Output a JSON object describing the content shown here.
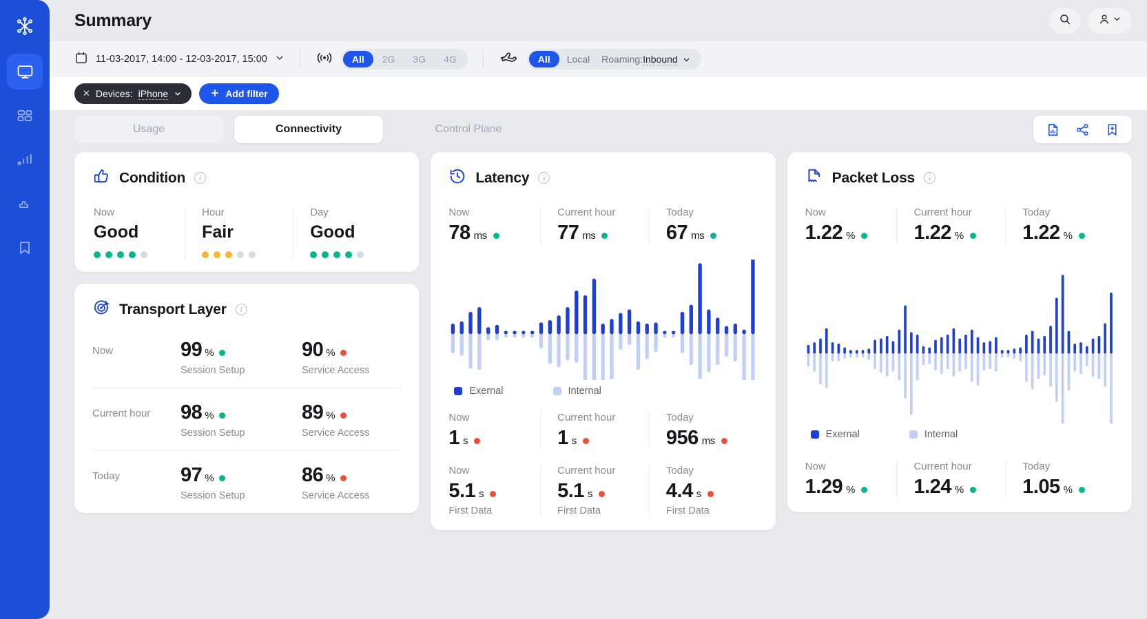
{
  "sidebar": {
    "items": [
      {
        "icon": "network-nodes-logo-icon",
        "name": "logo"
      },
      {
        "icon": "monitor-icon",
        "name": "monitoring",
        "active": true
      },
      {
        "icon": "dashboard-grid-icon",
        "name": "dashboards"
      },
      {
        "icon": "bar-chart-icon",
        "name": "analytics"
      },
      {
        "icon": "puzzle-icon",
        "name": "integrations"
      },
      {
        "icon": "bookmark-icon",
        "name": "saved"
      }
    ]
  },
  "header": {
    "title": "Summary",
    "search_icon": "search-icon",
    "user_icon": "user-icon",
    "chevron_icon": "chevron-down-icon"
  },
  "filters": {
    "calendar_icon": "calendar-icon",
    "date_range": "11-03-2017, 14:00 - 12-03-2017, 15:00",
    "date_chevron": "chevron-down-icon",
    "network_icon": "signal-waves-icon",
    "network_options": [
      "All",
      "2G",
      "3G",
      "4G"
    ],
    "network_selected": "All",
    "roaming_icon": "airplane-icon",
    "roaming_options": [
      "All",
      "Local"
    ],
    "roaming_selected": "All",
    "roaming_label": "Roaming:",
    "roaming_value": "Inbound",
    "roaming_value_chevron": "chevron-down-icon",
    "chip": {
      "close_icon": "close-x-icon",
      "label": "Devices:",
      "value": "iPhone",
      "chevron": "chevron-down-icon"
    },
    "add_filter": {
      "plus_icon": "plus-icon",
      "label": "Add filter"
    }
  },
  "tabs": {
    "items": [
      {
        "label": "Usage",
        "active": false,
        "muted": false
      },
      {
        "label": "Connectivity",
        "active": true,
        "muted": false
      },
      {
        "label": "Control Plane",
        "active": false,
        "muted": true
      }
    ],
    "actions": [
      {
        "icon": "report-document-icon"
      },
      {
        "icon": "share-icon"
      },
      {
        "icon": "bookmark-add-icon"
      }
    ]
  },
  "cards": {
    "condition": {
      "icon": "thumbs-up-icon",
      "title": "Condition",
      "info_icon": "info-icon",
      "cells": [
        {
          "label": "Now",
          "value": "Good",
          "filled": 4,
          "total": 5,
          "color": "green"
        },
        {
          "label": "Hour",
          "value": "Fair",
          "filled": 3,
          "total": 5,
          "color": "amber"
        },
        {
          "label": "Day",
          "value": "Good",
          "filled": 4,
          "total": 5,
          "color": "green"
        }
      ]
    },
    "transport_layer": {
      "icon": "target-dart-icon",
      "title": "Transport Layer",
      "info_icon": "info-icon",
      "rows": [
        {
          "label": "Now",
          "metrics": [
            {
              "value": "99",
              "unit": "%",
              "status": "green",
              "sub": "Session Setup"
            },
            {
              "value": "90",
              "unit": "%",
              "status": "red",
              "sub": "Service Access"
            }
          ]
        },
        {
          "label": "Current hour",
          "metrics": [
            {
              "value": "98",
              "unit": "%",
              "status": "green",
              "sub": "Session Setup"
            },
            {
              "value": "89",
              "unit": "%",
              "status": "red",
              "sub": "Service Access"
            }
          ]
        },
        {
          "label": "Today",
          "metrics": [
            {
              "value": "97",
              "unit": "%",
              "status": "green",
              "sub": "Session Setup"
            },
            {
              "value": "86",
              "unit": "%",
              "status": "red",
              "sub": "Service Access"
            }
          ]
        }
      ]
    },
    "latency": {
      "icon": "clock-history-icon",
      "title": "Latency",
      "info_icon": "info-icon",
      "top_stats": [
        {
          "label": "Now",
          "value": "78",
          "unit": "ms",
          "status": "green"
        },
        {
          "label": "Current hour",
          "value": "77",
          "unit": "ms",
          "status": "green"
        },
        {
          "label": "Today",
          "value": "67",
          "unit": "ms",
          "status": "green"
        }
      ],
      "legend": [
        {
          "label": "Exernal",
          "color": "#1d3fd8"
        },
        {
          "label": "Internal",
          "color": "#c2d0f7"
        }
      ],
      "mid_stats": [
        {
          "label": "Now",
          "value": "1",
          "unit": "s",
          "status": "red"
        },
        {
          "label": "Current hour",
          "value": "1",
          "unit": "s",
          "status": "red"
        },
        {
          "label": "Today",
          "value": "956",
          "unit": "ms",
          "status": "red"
        }
      ],
      "bottom_stats": [
        {
          "label": "Now",
          "value": "5.1",
          "unit": "s",
          "status": "red",
          "sub": "First Data"
        },
        {
          "label": "Current hour",
          "value": "5.1",
          "unit": "s",
          "status": "red",
          "sub": "First Data"
        },
        {
          "label": "Today",
          "value": "4.4",
          "unit": "s",
          "status": "red",
          "sub": "First Data"
        }
      ]
    },
    "packet_loss": {
      "icon": "packet-torn-icon",
      "title": "Packet Loss",
      "info_icon": "info-icon",
      "top_stats": [
        {
          "label": "Now",
          "value": "1.22",
          "unit": "%",
          "status": "green"
        },
        {
          "label": "Current hour",
          "value": "1.22",
          "unit": "%",
          "status": "green"
        },
        {
          "label": "Today",
          "value": "1.22",
          "unit": "%",
          "status": "green"
        }
      ],
      "legend": [
        {
          "label": "Exernal",
          "color": "#1d3fd8"
        },
        {
          "label": "Internal",
          "color": "#c2d0f7"
        }
      ],
      "bottom_stats": [
        {
          "label": "Now",
          "value": "1.29",
          "unit": "%",
          "status": "green"
        },
        {
          "label": "Current hour",
          "value": "1.24",
          "unit": "%",
          "status": "green"
        },
        {
          "label": "Today",
          "value": "1.05",
          "unit": "%",
          "status": "green"
        }
      ]
    }
  },
  "colors": {
    "brand_blue": "#1d56e8",
    "series_external": "#1d3fd8",
    "series_internal": "#c2d0f7",
    "status_green": "#09b491",
    "status_red": "#e8503a",
    "status_amber": "#f7b733"
  },
  "chart_data": [
    {
      "id": "latency-chart",
      "type": "bar",
      "title": "Latency",
      "orientation": "bidirectional",
      "series": [
        {
          "name": "Exernal",
          "color": "#1d3fd8",
          "direction": "up",
          "values": [
            9,
            11,
            19,
            23,
            6,
            8,
            2,
            2,
            2,
            2,
            10,
            12,
            16,
            23,
            37,
            33,
            47,
            9,
            13,
            18,
            21,
            11,
            9,
            10,
            2,
            2,
            19,
            25,
            60,
            21,
            14,
            7,
            9,
            4,
            66
          ]
        },
        {
          "name": "Internal",
          "color": "#c2d0f7",
          "direction": "down",
          "values": [
            16,
            18,
            29,
            30,
            5,
            5,
            3,
            3,
            3,
            3,
            12,
            25,
            28,
            22,
            24,
            42,
            60,
            50,
            38,
            13,
            9,
            30,
            21,
            15,
            3,
            3,
            16,
            26,
            38,
            32,
            26,
            19,
            23,
            40,
            58
          ]
        }
      ],
      "xlabel": "",
      "ylabel": "",
      "grid": false,
      "legend": "bottom-left"
    },
    {
      "id": "packet-loss-chart",
      "type": "bar",
      "title": "Packet Loss",
      "orientation": "bidirectional",
      "series": [
        {
          "name": "Exernal",
          "color": "#1d3fd8",
          "direction": "up",
          "values": [
            7,
            9,
            12,
            20,
            9,
            8,
            5,
            3,
            3,
            3,
            4,
            11,
            12,
            14,
            10,
            19,
            38,
            17,
            15,
            6,
            5,
            11,
            13,
            15,
            20,
            12,
            15,
            19,
            13,
            9,
            10,
            13,
            3,
            3,
            4,
            5,
            15,
            18,
            12,
            14,
            22,
            44,
            62,
            18,
            8,
            9,
            6,
            12,
            14,
            24,
            48
          ]
        },
        {
          "name": "Internal",
          "color": "#c2d0f7",
          "direction": "down",
          "values": [
            10,
            14,
            24,
            27,
            6,
            6,
            4,
            3,
            3,
            3,
            5,
            12,
            15,
            18,
            14,
            21,
            35,
            48,
            21,
            9,
            8,
            13,
            16,
            12,
            18,
            14,
            12,
            22,
            25,
            13,
            12,
            14,
            3,
            3,
            4,
            6,
            22,
            28,
            20,
            17,
            26,
            38,
            70,
            29,
            14,
            16,
            10,
            18,
            20,
            26,
            56
          ]
        }
      ],
      "xlabel": "",
      "ylabel": "",
      "grid": false,
      "legend": "bottom-left"
    }
  ]
}
